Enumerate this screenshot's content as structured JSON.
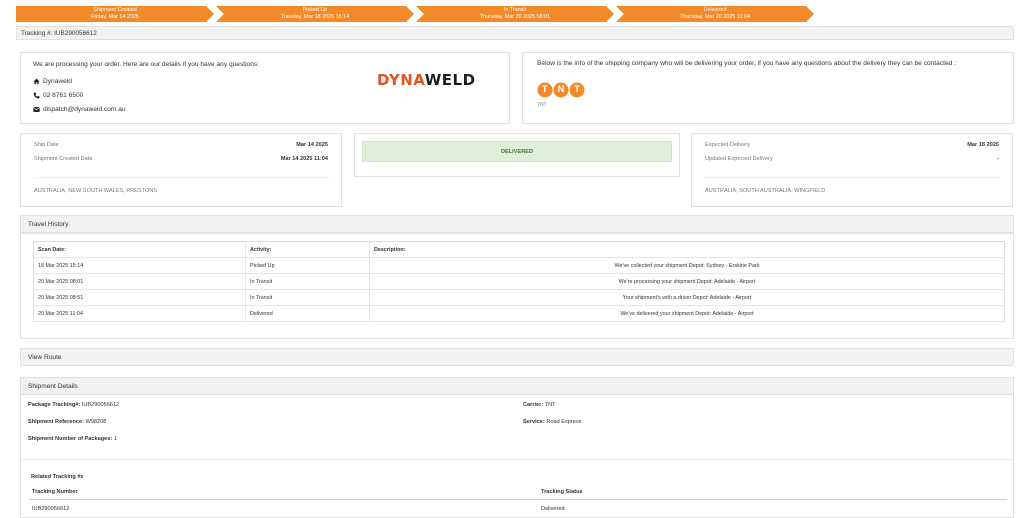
{
  "progress": [
    {
      "title": "Shipment Created",
      "date": "Friday, Mar 14 2025"
    },
    {
      "title": "Picked Up",
      "date": "Tuesday, Mar 18 2025 15:14"
    },
    {
      "title": "In Transit",
      "date": "Thursday, Mar 20 2025 08:01"
    },
    {
      "title": "Delivered",
      "date": "Thursday, Mar 20 2025 11:04"
    }
  ],
  "tracking_bar": "Tracking #: IUB290056612",
  "company": {
    "intro": "We are processing your order. Here are our details if you have any questions:",
    "name": "Dynaweld",
    "phone": "02 8761 6500",
    "email": "dispatch@dynaweld.com.au",
    "logo_a": "DYNA",
    "logo_b": "WELD",
    "brand_color": "#e8541e"
  },
  "carrier": {
    "intro": "Below is the info of the shipping company who will be delivering your order, if you have any questions about the delivery they can be contacted :",
    "logo": "TNT",
    "logo_sub": "TNT",
    "brand_color": "#f28a2a"
  },
  "ship": {
    "ship_date_label": "Ship Date",
    "ship_date": "Mar 14 2025",
    "created_label": "Shipment Created Date",
    "created": "Mar 14 2025 11:04",
    "origin": "AUSTRALIA, NEW SOUTH WALES, PRESTONS"
  },
  "status": {
    "label": "DELIVERED",
    "bg": "#dff0d8",
    "color": "#3c763d"
  },
  "expected": {
    "exp_label": "Expected Delivery",
    "exp": "Mar 18 2025",
    "upd_label": "Updated Expected Delivery",
    "upd": "-",
    "dest": "AUSTRALIA, SOUTH AUSTRALIA, WINGFIELD"
  },
  "travel_history": {
    "title": "Travel History",
    "columns": [
      "Scan Date:",
      "Activity:",
      "Description:"
    ],
    "rows": [
      {
        "date": "18 Mar 2025 15:14",
        "activity": "Picked Up",
        "desc": "We've collected your shipment Depot: Sydney - Erskine Park"
      },
      {
        "date": "20 Mar 2025 08:01",
        "activity": "In Transit",
        "desc": "We're processing your shipment Depot: Adelaide - Airport"
      },
      {
        "date": "20 Mar 2025 08:51",
        "activity": "In Transit",
        "desc": "Your shipment's with a driver Depot: Adelaide - Airport"
      },
      {
        "date": "20 Mar 2025 11:04",
        "activity": "Delivered",
        "desc": "We've delivered your shipment Depot: Adelaide - Airport"
      }
    ]
  },
  "view_route": "View Route",
  "shipment_details": {
    "title": "Shipment Details",
    "pkg_label": "Package Tracking#:",
    "pkg": "IUB290056612",
    "ref_label": "Shipment Reference:",
    "ref": "W98208",
    "num_label": "Shipment Number of Packages:",
    "num": "1",
    "carrier_label": "Carrier:",
    "carrier": "TNT",
    "service_label": "Service:",
    "service": "Road Express",
    "related_title": "Related Tracking #s",
    "col_number": "Tracking Number",
    "col_status": "Tracking Status",
    "rel_number": "IUB290056612",
    "rel_status": "Delivered"
  }
}
